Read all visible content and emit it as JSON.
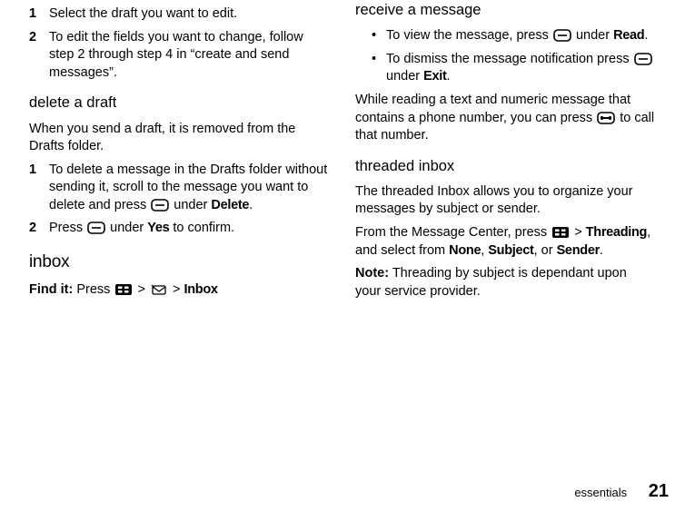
{
  "col1": {
    "step1_num": "1",
    "step1_body": "Select the draft you want to edit.",
    "step2_num": "2",
    "step2_body": "To edit the fields you want to change, follow step 2 through step 4 in “create and send messages”.",
    "h_delete": "delete a draft",
    "p_delete": "When you send a draft, it is removed from the Drafts folder.",
    "del1_num": "1",
    "del1_a": "To delete a message in the Drafts folder without sending it, scroll to the message you want to delete and press ",
    "del1_b": " under ",
    "del1_c": "Delete",
    "del1_d": ".",
    "del2_num": "2",
    "del2_a": "Press ",
    "del2_b": " under ",
    "del2_c": "Yes",
    "del2_d": " to confirm.",
    "h_inbox": "inbox",
    "findit_label": "Find it:",
    "findit_a": " Press ",
    "findit_b": " > ",
    "findit_c": " > ",
    "findit_end": "Inbox"
  },
  "col2": {
    "h_receive": "receive a message",
    "r1_a": "To view the message, press ",
    "r1_b": " under ",
    "r1_c": "Read",
    "r1_d": ".",
    "r2_a": "To dismiss the message notification press ",
    "r2_b": " under ",
    "r2_c": "Exit",
    "r2_d": ".",
    "p_while_a": "While reading a text and numeric message that contains a phone number, you can press ",
    "p_while_b": " to call that number.",
    "h_thread": "threaded inbox",
    "p_thread": "The threaded Inbox allows you to organize your messages by subject or sender.",
    "from_a": "From the Message Center, press ",
    "from_b": " > ",
    "from_c": "Threading",
    "from_d": ", and select from ",
    "from_e": "None",
    "from_f": ", ",
    "from_g": "Subject",
    "from_h": ", or ",
    "from_i": "Sender",
    "from_j": ".",
    "note_label": "Note:",
    "note_body": " Threading by subject is dependant upon your service provider."
  },
  "footer": {
    "text": "essentials",
    "page": "21"
  }
}
